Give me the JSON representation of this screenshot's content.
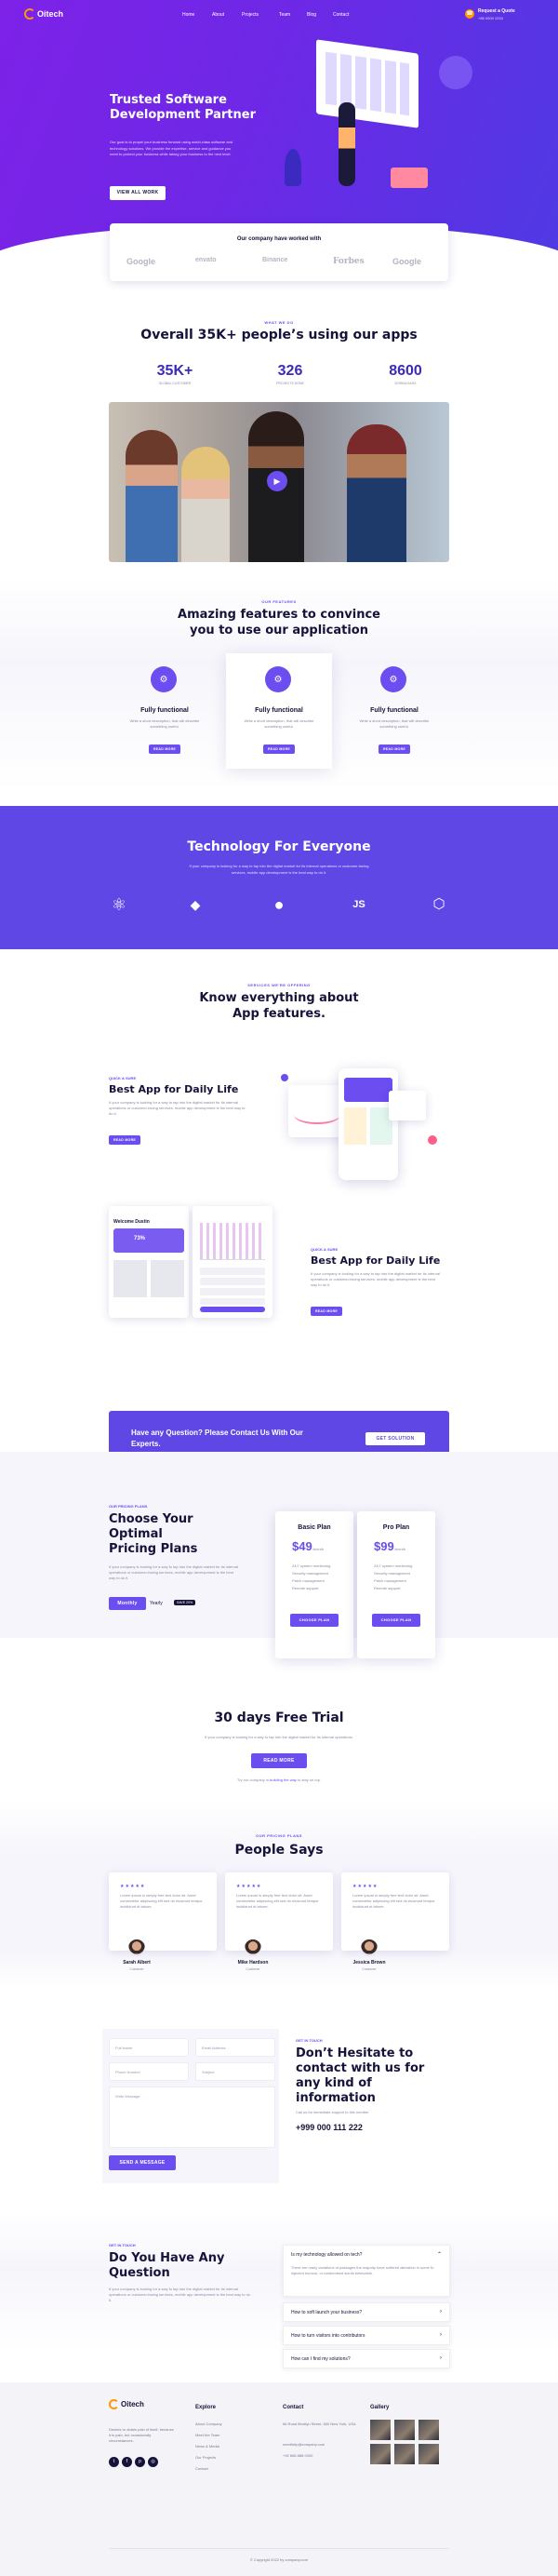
{
  "colors": {
    "primary": "#6b4df0",
    "hero_start": "#7e22e8",
    "hero_end": "#4f3ae4",
    "dark": "#15133a",
    "accent_orange": "#ff9800"
  },
  "nav": {
    "logo": "Oitech",
    "links": [
      "Home",
      "About",
      "Projects",
      "Team",
      "Blog",
      "Contact"
    ],
    "cta_title": "Request a Quote",
    "cta_phone": "+88 0000 1234"
  },
  "hero": {
    "title_line1": "Trusted Software",
    "title_line2": "Development Partner",
    "text": "Our goal is to propel your business forward using world-class software and technology solutions. We provide the expertise, service and guidance you need to protect your business while taking your business to the next level.",
    "button": "VIEW ALL WORK"
  },
  "partners": {
    "title": "Our company have worked with",
    "logos": [
      "Google",
      "envato",
      "Binance",
      "Forbes",
      "Google"
    ]
  },
  "stats": {
    "tag": "WHAT WE DO",
    "title": "Overall 35K+ people’s using our apps",
    "items": [
      {
        "value": "35K+",
        "label": "GLOBAL CUSTOMER"
      },
      {
        "value": "326",
        "label": "PROJECTS DONE"
      },
      {
        "value": "8600",
        "label": "DOWNLOADS"
      }
    ]
  },
  "features": {
    "tag": "OUR FEATURES",
    "title_line1": "Amazing features to convince",
    "title_line2": "you to use our application",
    "cards": [
      {
        "icon": "gear-icon",
        "title": "Fully functional",
        "text": "Write a short description, that will describe something useful.",
        "button": "READ MORE"
      },
      {
        "icon": "gear-icon",
        "title": "Fully functional",
        "text": "Write a short description, that will describe something useful.",
        "button": "READ MORE"
      },
      {
        "icon": "gear-icon",
        "title": "Fully functional",
        "text": "Write a short description, that will describe something useful.",
        "button": "READ MORE"
      }
    ]
  },
  "tech": {
    "title": "Technology For Everyone",
    "text": "If your company is looking for a way to tap into the digital market for its internal operations or customer-facing services, mobile app development is the best way to do it.",
    "icons": [
      "react-icon",
      "python-icon",
      "github-icon",
      "javascript-icon",
      "codepen-icon"
    ]
  },
  "app": {
    "tag": "SERVICES WE'RE OFFERING",
    "title_line1": "Know everything about",
    "title_line2": "App features.",
    "blocks": [
      {
        "tag": "QUICK & SURE",
        "title": "Best App for Daily Life",
        "text": "If your company is looking for a way to tap into the digital market for its internal operations or customer-facing services, mobile app development is the best way to do it.",
        "button": "READ MORE"
      },
      {
        "tag": "QUICK & SURE",
        "title": "Best App for Daily Life",
        "text": "If your company is looking for a way to tap into the digital market for its internal operations or customer-facing services, mobile app development is the best way to do it.",
        "button": "READ MORE"
      }
    ],
    "phone_title": "Welcome Dustin",
    "phone_progress": "73%"
  },
  "cta": {
    "text_line1": "Have any Question? Please Contact Us With Our",
    "text_line2": "Experts.",
    "button": "GET SOLUTION"
  },
  "pricing": {
    "tag": "OUR PRICING PLANS",
    "title_line1": "Choose Your Optimal",
    "title_line2": "Pricing Plans",
    "text": "If your company is looking for a way to tap into the digital market for its internal operations or customer-facing services, mobile app development is the best way to do it.",
    "toggle_monthly": "Monthly",
    "toggle_yearly": "Yearly",
    "save_badge": "SAVE 20%",
    "plans": [
      {
        "name": "Basic Plan",
        "price": "$49",
        "period": "/month",
        "features": [
          "24/7 system monitoring",
          "Security management",
          "Patch management",
          "Remote support"
        ],
        "button": "CHOOSE PLAN"
      },
      {
        "name": "Pro Plan",
        "price": "$99",
        "period": "/month",
        "features": [
          "24/7 system monitoring",
          "Security management",
          "Patch management",
          "Remote support"
        ],
        "button": "CHOOSE PLAN"
      }
    ]
  },
  "trial": {
    "title": "30 days Free Trial",
    "text": "If your company is looking for a way to tap into the digital market for its internal operations.",
    "button": "READ MORE",
    "link_pre": "Try our company in ",
    "link_text": "building the way",
    "link_post": " to stay on top."
  },
  "testimonials": {
    "tag": "OUR PRICING PLANS",
    "title": "People Says",
    "items": [
      {
        "stars": "★★★★★",
        "quote": "Lorem ipsum is simply free text dolor sit. Amet consectetur adipiscing elit sed do eiusmod tempor incididunt ut labore.",
        "name": "Sarah Albert",
        "role": "Customer"
      },
      {
        "stars": "★★★★★",
        "quote": "Lorem ipsum is simply free text dolor sit. Amet consectetur adipiscing elit sed do eiusmod tempor incididunt ut labore.",
        "name": "Mike Hardson",
        "role": "Customer"
      },
      {
        "stars": "★★★★★",
        "quote": "Lorem ipsum is simply free text dolor sit. Amet consectetur adipiscing elit sed do eiusmod tempor incididunt ut labore.",
        "name": "Jessica Brown",
        "role": "Customer"
      }
    ]
  },
  "contact": {
    "placeholders": {
      "name": "Full Name",
      "email": "Email Address",
      "phone": "Phone Number",
      "subject": "Subject",
      "message": "Write Message"
    },
    "button": "SEND A MESSAGE",
    "tag": "GET IN TOUCH",
    "title_line1": "Don’t Hesitate to",
    "title_line2": "contact with us for",
    "title_line3": "any kind of",
    "title_line4": "information",
    "text": "Call us for immediate support to this number",
    "phone": "+999 000 111 222"
  },
  "faq": {
    "tag": "GET IN TOUCH",
    "title_line1": "Do You Have Any",
    "title_line2": "Question",
    "text": "If your company is looking for a way to tap into the digital market for its internal operations or customer-facing services, mobile app development is the best way to do it.",
    "items": [
      {
        "q": "Is my technology allowed on tech?",
        "a": "There are many variations of passages the majority have suffered alteration in some fo injected humour, or randomised words believable."
      },
      {
        "q": "How to soft launch your business?"
      },
      {
        "q": "How to turn visitors into contributors"
      },
      {
        "q": "How can I find my solutions?"
      }
    ]
  },
  "footer": {
    "logo": "Oitech",
    "about": "Desires to obtain pain of itself, because it is pain, but occasionally circumstances.",
    "explore_title": "Explore",
    "explore": [
      "About Company",
      "Meet the Team",
      "News & Media",
      "Our Projects",
      "Contact"
    ],
    "contact_title": "Contact",
    "contact": [
      "66 Road Broklyn Street, 600 New York, USA",
      "needhelp@company.com",
      "+92 666 888 0000"
    ],
    "gallery_title": "Gallery",
    "copyright": "© Copyright 2022 by company.com"
  }
}
